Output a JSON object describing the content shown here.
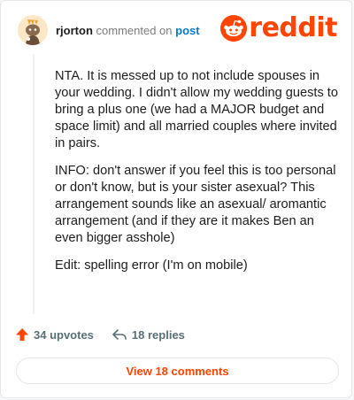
{
  "header": {
    "username": "rjorton",
    "action_text": "commented on",
    "target_link": "post",
    "logo_text": "reddit",
    "brand_color": "#ff4500",
    "link_color": "#0079d3",
    "avatar_icon": "snoo-avatar-icon"
  },
  "comment": {
    "paragraphs": [
      "NTA. It is messed up to not include spouses in your wedding. I didn't allow my wedding guests to bring a plus one (we had a MAJOR budget and space limit) and all married couples where invited in pairs.",
      "INFO: don't answer if you feel this is too personal or don't know, but is your sister asexual? This arrangement sounds like an asexual/ aromantic arrangement (and if they are it makes Ben an even bigger asshole)",
      "Edit: spelling error (I'm on mobile)"
    ]
  },
  "actions": {
    "upvotes_label": "34 upvotes",
    "upvote_icon": "upvote-arrow-icon",
    "upvote_color": "#ff4500",
    "replies_label": "18 replies",
    "reply_icon": "reply-arrow-icon"
  },
  "footer": {
    "view_comments_label": "View 18 comments"
  }
}
